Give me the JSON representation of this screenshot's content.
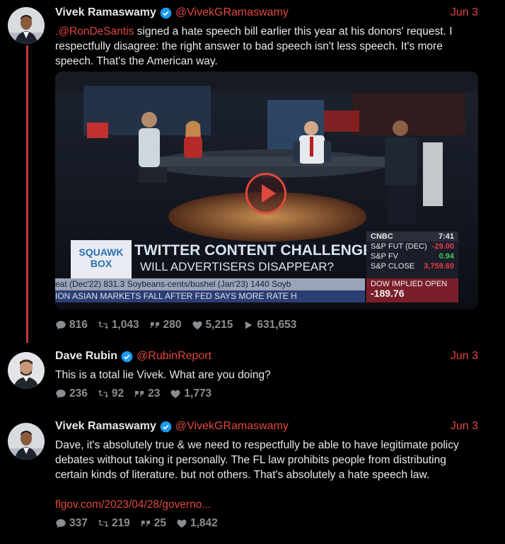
{
  "tweets": [
    {
      "name": "Vivek Ramaswamy",
      "handle": "@VivekGRamaswamy",
      "date": "Jun 3",
      "mention": ".@RonDeSantis",
      "text": " signed a hate speech bill earlier this year at his donors' request. I respectfully disagree: the right answer to bad speech isn't less speech. It's more speech. That's the American way.",
      "stats": {
        "replies": "816",
        "retweets": "1,043",
        "quotes": "280",
        "likes": "5,215",
        "views": "631,653"
      }
    },
    {
      "name": "Dave Rubin",
      "handle": "@RubinReport",
      "date": "Jun 3",
      "text": "This is a total lie Vivek. What are you doing?",
      "stats": {
        "replies": "236",
        "retweets": "92",
        "quotes": "23",
        "likes": "1,773"
      }
    },
    {
      "name": "Vivek Ramaswamy",
      "handle": "@VivekGRamaswamy",
      "date": "Jun 3",
      "text": "Dave, it's absolutely true & we need to respectfully be able to have legitimate policy debates without taking it personally. The FL law prohibits people from distributing certain kinds of literature. but not others. That's absolutely a hate speech law.",
      "link": "flgov.com/2023/04/28/governo...",
      "stats": {
        "replies": "337",
        "retweets": "219",
        "quotes": "25",
        "likes": "1,842"
      }
    }
  ],
  "video": {
    "show_logo": "SQUAWK BOX",
    "headline_1": "TWITTER CONTENT CHALLENGES",
    "headline_2": "WILL ADVERTISERS DISAPPEAR?",
    "network": "CNBC",
    "clock": "7:41",
    "market": [
      {
        "label": "S&P FUT (DEC)",
        "value": "-29.00"
      },
      {
        "label": "S&P FV",
        "value": "0.94"
      },
      {
        "label": "S&P CLOSE",
        "value": "3,759.69"
      }
    ],
    "ticker_1": "eat (Dec'22) 831.3    Soybeans-cents/bushel (Jan'23) 1440    Soyb",
    "ticker_2": "ION    ASIAN MARKETS FALL AFTER FED SAYS MORE RATE H",
    "dow_label": "DOW IMPLIED OPEN",
    "dow_value": "-189.76"
  },
  "colors": {
    "accent": "#e0473f",
    "thread_line": "#c0393c",
    "verified": "#1d9bf0"
  }
}
